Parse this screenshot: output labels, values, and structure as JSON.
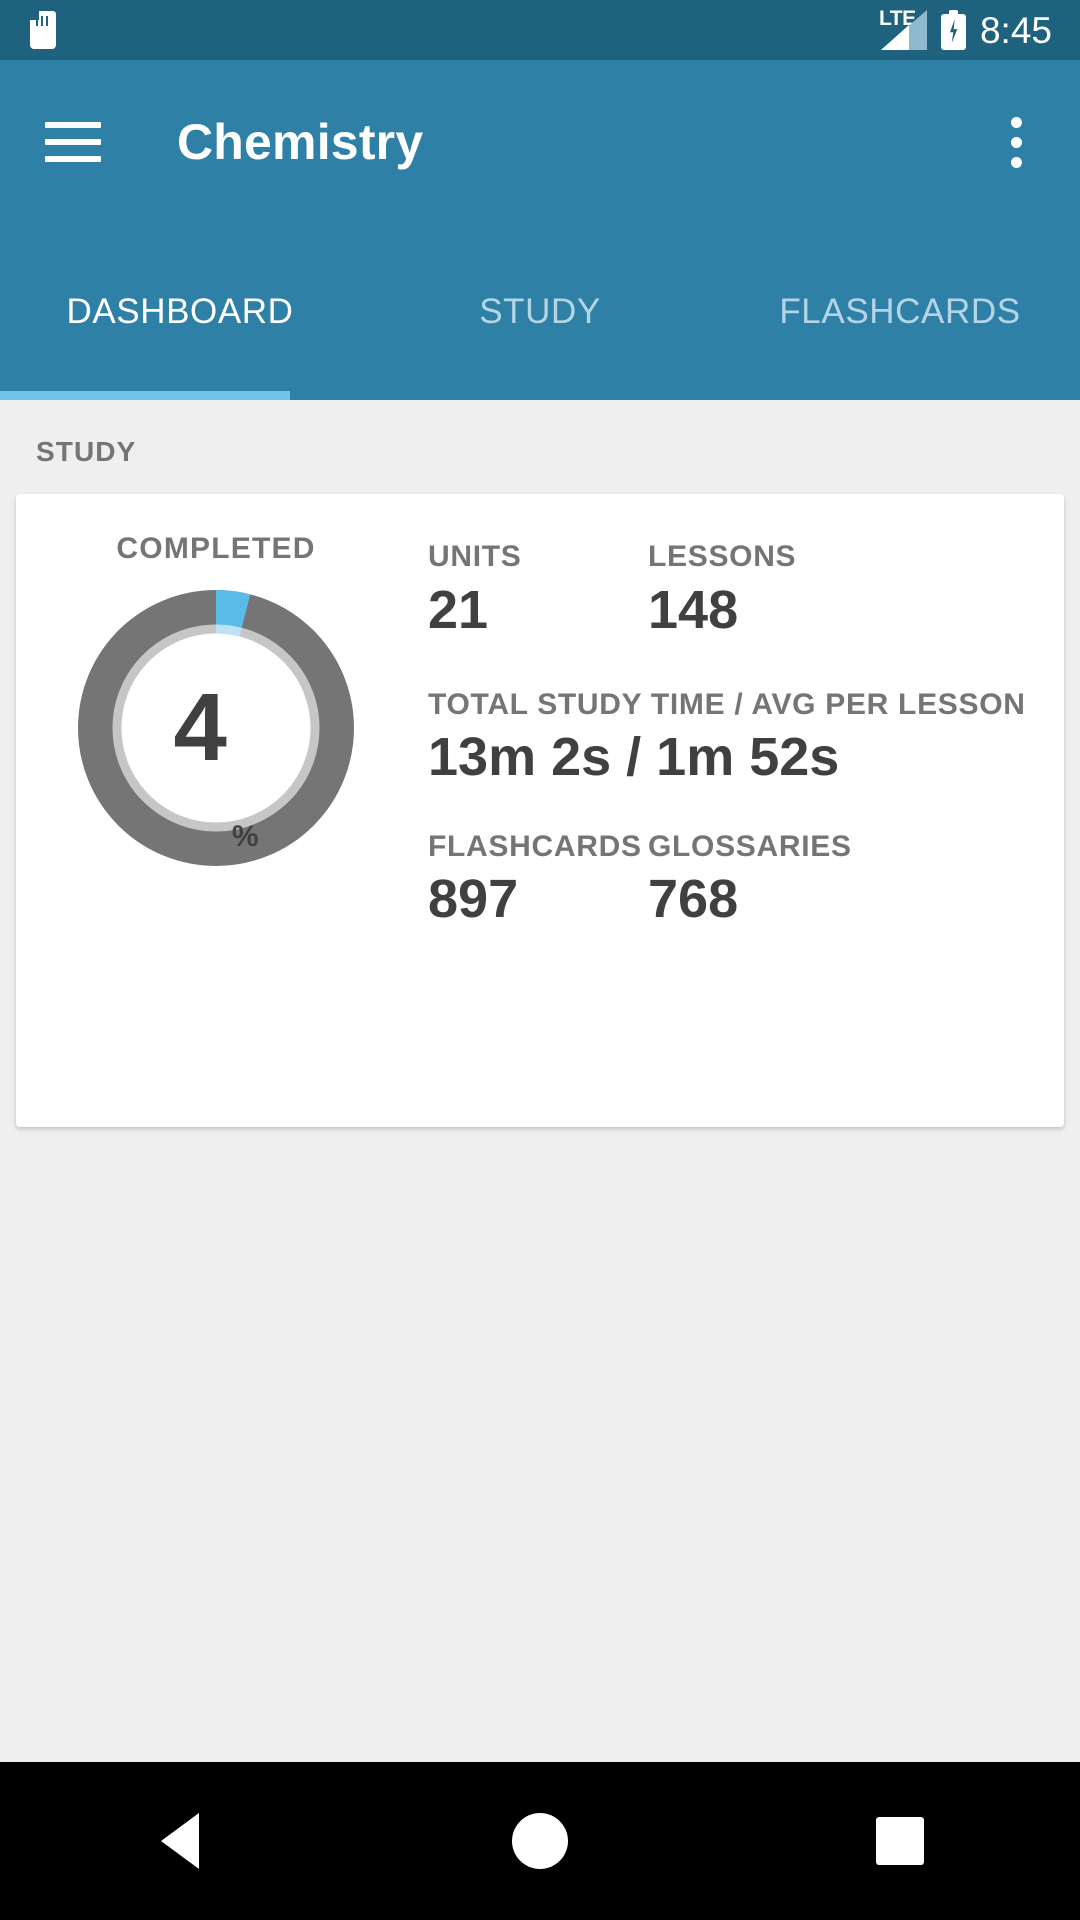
{
  "status_bar": {
    "sd_icon": "sdcard-icon",
    "network_label": "LTE",
    "signal_icon": "signal-bars-icon",
    "battery_icon": "battery-charging-icon",
    "time": "8:45",
    "background_color": "#1e627d"
  },
  "app_bar": {
    "menu_icon": "hamburger-menu-icon",
    "title": "Chemistry",
    "overflow_icon": "overflow-menu-icon",
    "background_color": "#2e80a6"
  },
  "tabs": {
    "items": [
      {
        "label": "DASHBOARD",
        "active": true
      },
      {
        "label": "STUDY",
        "active": false
      },
      {
        "label": "FLASHCARDS",
        "active": false
      }
    ],
    "indicator_color": "#72c3ea",
    "active_color": "#ffffff",
    "inactive_color": "#b5d4e4"
  },
  "content": {
    "section_label": "STUDY",
    "card": {
      "donut": {
        "title": "COMPLETED",
        "value": "4",
        "unit": "%",
        "track_color": "#757575",
        "progress_color": "#5bbbe8",
        "inner_ring_color": "#c6c6c6"
      },
      "stats": [
        {
          "label": "UNITS",
          "value": "21"
        },
        {
          "label": "LESSONS",
          "value": "148"
        },
        {
          "label": "TOTAL STUDY TIME / AVG PER LESSON",
          "value": "13m 2s / 1m 52s"
        },
        {
          "label": "FLASHCARDS",
          "value": "897"
        },
        {
          "label": "GLOSSARIES",
          "value": "768"
        }
      ]
    }
  },
  "nav_bar": {
    "back_icon": "back-triangle-icon",
    "home_icon": "home-circle-icon",
    "recents_icon": "recents-square-icon"
  },
  "chart_data": {
    "type": "pie",
    "title": "COMPLETED",
    "categories": [
      "Completed",
      "Remaining"
    ],
    "values": [
      4,
      96
    ],
    "unit": "%",
    "center_label": "4%",
    "colors": [
      "#5bbbe8",
      "#757575"
    ]
  }
}
